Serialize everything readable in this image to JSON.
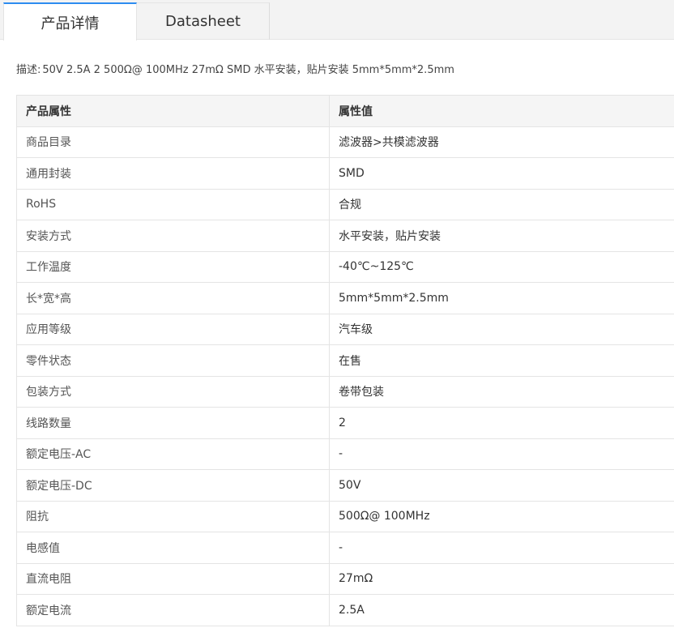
{
  "tabs": {
    "details": "产品详情",
    "datasheet": "Datasheet"
  },
  "description": {
    "label": "描述:",
    "text": "50V 2.5A 2 500Ω@ 100MHz 27mΩ SMD 水平安装，贴片安装 5mm*5mm*2.5mm"
  },
  "table": {
    "headers": [
      "产品属性",
      "属性值"
    ],
    "rows": [
      {
        "prop": "商品目录",
        "value": "滤波器>共模滤波器"
      },
      {
        "prop": "通用封装",
        "value": "SMD"
      },
      {
        "prop": "RoHS",
        "value": "合规"
      },
      {
        "prop": "安装方式",
        "value": "水平安装，贴片安装"
      },
      {
        "prop": "工作温度",
        "value": "-40℃~125℃"
      },
      {
        "prop": "长*宽*高",
        "value": "5mm*5mm*2.5mm"
      },
      {
        "prop": "应用等级",
        "value": "汽车级"
      },
      {
        "prop": "零件状态",
        "value": "在售"
      },
      {
        "prop": "包装方式",
        "value": "卷带包装"
      },
      {
        "prop": "线路数量",
        "value": "2"
      },
      {
        "prop": "额定电压-AC",
        "value": "-"
      },
      {
        "prop": "额定电压-DC",
        "value": "50V"
      },
      {
        "prop": "阻抗",
        "value": "500Ω@ 100MHz"
      },
      {
        "prop": "电感值",
        "value": "-"
      },
      {
        "prop": "直流电阻",
        "value": "27mΩ"
      },
      {
        "prop": "额定电流",
        "value": "2.5A"
      }
    ]
  },
  "colors": {
    "active_tab_accent": "#2d8cf0",
    "header_bg": "#f5f5f5",
    "border": "#e4e4e4"
  }
}
